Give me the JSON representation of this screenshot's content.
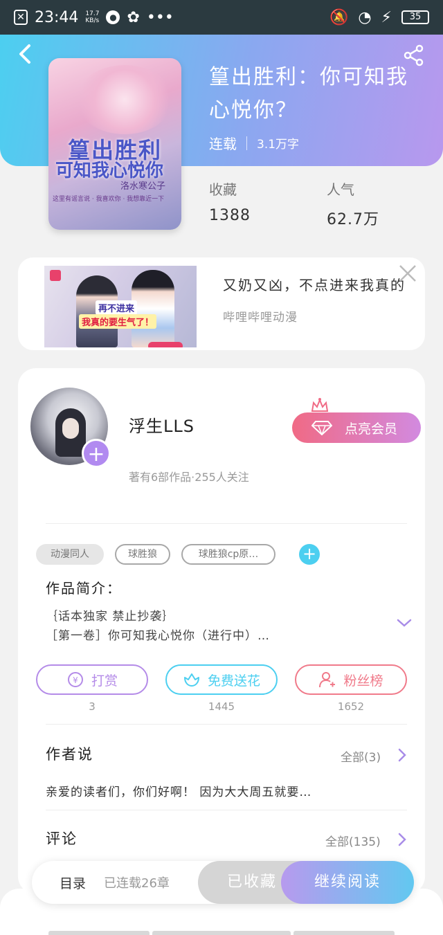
{
  "status_bar": {
    "time": "23:44",
    "net_speed": "17.7",
    "net_unit": "KB/s",
    "battery": "35"
  },
  "book": {
    "title": "篁出胜利：你可知我心悦你？",
    "status": "连载",
    "word_count": "3.1万字",
    "cover_title_line1": "篁出胜利",
    "cover_title_line2": "可知我心悦你",
    "cover_author": "洛水寒公子",
    "cover_tagline": "这里有谣言说 · 我喜欢你 · 我想靠近一下"
  },
  "stats": {
    "collect_label": "收藏",
    "collect_value": "1388",
    "popularity_label": "人气",
    "popularity_value": "62.7万"
  },
  "ad": {
    "headline": "又奶又凶，不点进来我真的",
    "source": "哔哩哔哩动漫",
    "image_line1": "再不进来",
    "image_line2": "我真的要生气了！"
  },
  "author": {
    "name": "浮生LLS",
    "info": "著有6部作品·255人关注",
    "vip_label": "点亮会员"
  },
  "tags": [
    "动漫同人",
    "球胜狼",
    "球胜狼cp原…"
  ],
  "intro": {
    "label": "作品简介：",
    "line1": "｛话本独家 禁止抄袭｝",
    "line2": "［第一卷］你可知我心悦你（进行中）…"
  },
  "actions": [
    {
      "label": "打赏",
      "count": "3",
      "color": "#b48be8"
    },
    {
      "label": "免费送花",
      "count": "1445",
      "color": "#4ccff0"
    },
    {
      "label": "粉丝榜",
      "count": "1652",
      "color": "#f07a8a"
    }
  ],
  "author_say": {
    "title": "作者说",
    "all": "全部(3)",
    "preview": "亲爱的读者们，你们好啊！ 因为大大周五就要…"
  },
  "comments": {
    "title": "评论",
    "all": "全部(135)"
  },
  "bottom": {
    "toc": "目录",
    "chapters": "已连载26章",
    "collected": "已收藏",
    "read": "继续阅读"
  }
}
